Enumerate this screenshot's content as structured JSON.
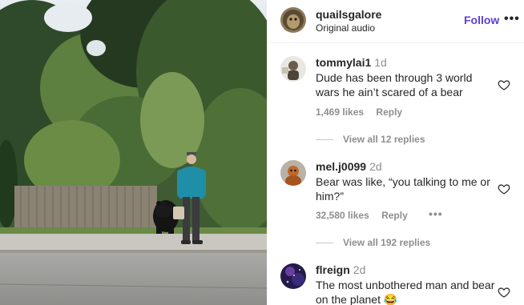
{
  "post": {
    "username": "quailsgalore",
    "audio": "Original audio",
    "follow_label": "Follow",
    "more_icon": "more-options-icon"
  },
  "comments": [
    {
      "username": "tommylai1",
      "age": "1d",
      "text": "Dude has been through 3 world wars he ain’t scared of a bear",
      "likes": "1,469 likes",
      "reply_label": "Reply",
      "view_replies": "View all 12 replies"
    },
    {
      "username": "mel.j0099",
      "age": "2d",
      "text": "Bear was like, “you talking to me or him?”",
      "likes": "32,580 likes",
      "reply_label": "Reply",
      "view_replies": "View all 192 replies"
    },
    {
      "username": "flreign",
      "age": "2d",
      "text": "The most unbothered man and bear on the planet",
      "emoji": "😂"
    }
  ],
  "colors": {
    "follow": "#5e3ed6",
    "muted": "#8e8e8e",
    "text": "#262626"
  }
}
